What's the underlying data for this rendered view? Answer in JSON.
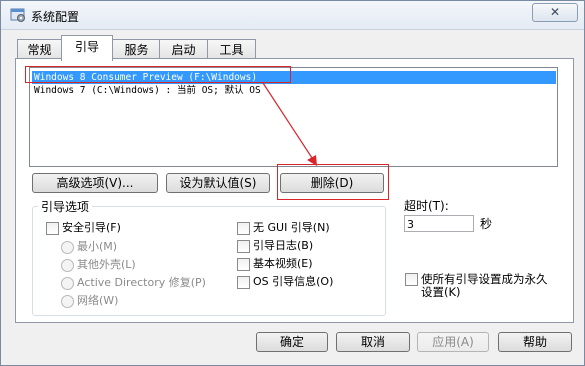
{
  "window": {
    "title": "系统配置",
    "close_symbol": "✕"
  },
  "tabs": [
    {
      "label": "常规"
    },
    {
      "label": "引导"
    },
    {
      "label": "服务"
    },
    {
      "label": "启动"
    },
    {
      "label": "工具"
    }
  ],
  "boot_entries": [
    {
      "text": "Windows 8 Consumer Preview (F:\\Windows)"
    },
    {
      "text": "Windows 7 (C:\\Windows) : 当前 OS; 默认 OS"
    }
  ],
  "entry_buttons": {
    "advanced": "高级选项(V)...",
    "set_default": "设为默认值(S)",
    "delete": "删除(D)"
  },
  "boot_options": {
    "title": "引导选项",
    "safe_boot": "安全引导(F)",
    "minimal": "最小(M)",
    "alternate_shell": "其他外壳(L)",
    "ad_repair": "Active Directory 修复(P)",
    "network": "网络(W)",
    "no_gui": "无 GUI 引导(N)",
    "boot_log": "引导日志(B)",
    "base_video": "基本视频(E)",
    "os_info": "OS 引导信息(O)"
  },
  "timeout": {
    "label": "超时(T):",
    "value": "3",
    "unit": "秒"
  },
  "permanent": {
    "line1": "使所有引导设置成为永久",
    "line2": "设置(K)"
  },
  "footer_buttons": {
    "ok": "确定",
    "cancel": "取消",
    "apply": "应用(A)",
    "help": "帮助"
  },
  "colors": {
    "selection": "#3399ff",
    "annotation": "#d9262a"
  }
}
